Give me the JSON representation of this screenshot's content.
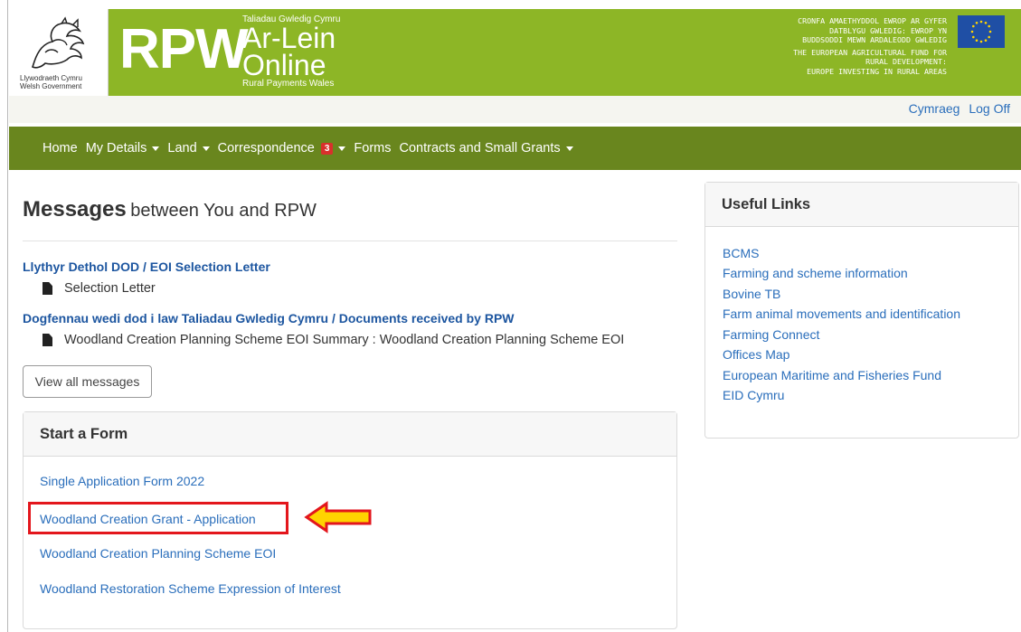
{
  "header": {
    "gov_text_1": "Llywodraeth Cymru",
    "gov_text_2": "Welsh Government",
    "rpw": "RPW",
    "ar_small": "Taliadau Gwledig Cymru",
    "ar_lein": "Ar-Lein",
    "online": "Online",
    "ar_sub": "Rural Payments Wales",
    "eu_welsh": [
      "CRONFA AMAETHYDDOL EWROP AR GYFER",
      "DATBLYGU GWLEDIG: EWROP YN",
      "BUDDSODDI MEWN ARDALEODD GWLEDIG"
    ],
    "eu_english": [
      "THE EUROPEAN AGRICULTURAL FUND FOR",
      "RURAL DEVELOPMENT:",
      "EUROPE INVESTING IN RURAL AREAS"
    ]
  },
  "util": {
    "cymraeg": "Cymraeg",
    "logoff": "Log Off"
  },
  "nav": {
    "home": "Home",
    "my_details": "My Details",
    "land": "Land",
    "correspondence": "Correspondence",
    "badge": "3",
    "forms": "Forms",
    "contracts": "Contracts and Small Grants"
  },
  "messages": {
    "title_bold": "Messages",
    "title_rest": "between You and RPW",
    "items": [
      {
        "title": "Llythyr Dethol DOD / EOI Selection Letter",
        "doc": "Selection Letter"
      },
      {
        "title": "Dogfennau wedi dod i law Taliadau Gwledig Cymru / Documents received by RPW",
        "doc": "Woodland Creation Planning Scheme EOI Summary : Woodland Creation Planning Scheme EOI"
      }
    ],
    "view_all": "View all messages"
  },
  "start_form": {
    "heading": "Start a Form",
    "links": [
      "Single Application Form 2022",
      "Woodland Creation Grant - Application",
      "Woodland Creation Planning Scheme EOI",
      "Woodland Restoration Scheme Expression of Interest"
    ]
  },
  "useful_links": {
    "heading": "Useful Links",
    "links": [
      "BCMS",
      "Farming and scheme information",
      "Bovine TB",
      "Farm animal movements and identification",
      "Farming Connect",
      "Offices Map",
      "European Maritime and Fisheries Fund",
      "EID Cymru"
    ]
  },
  "colors": {
    "banner": "#8db626",
    "nav": "#69861e",
    "link": "#2a6ebb",
    "highlight": "#e3161c",
    "arrow": "#ffd400"
  }
}
